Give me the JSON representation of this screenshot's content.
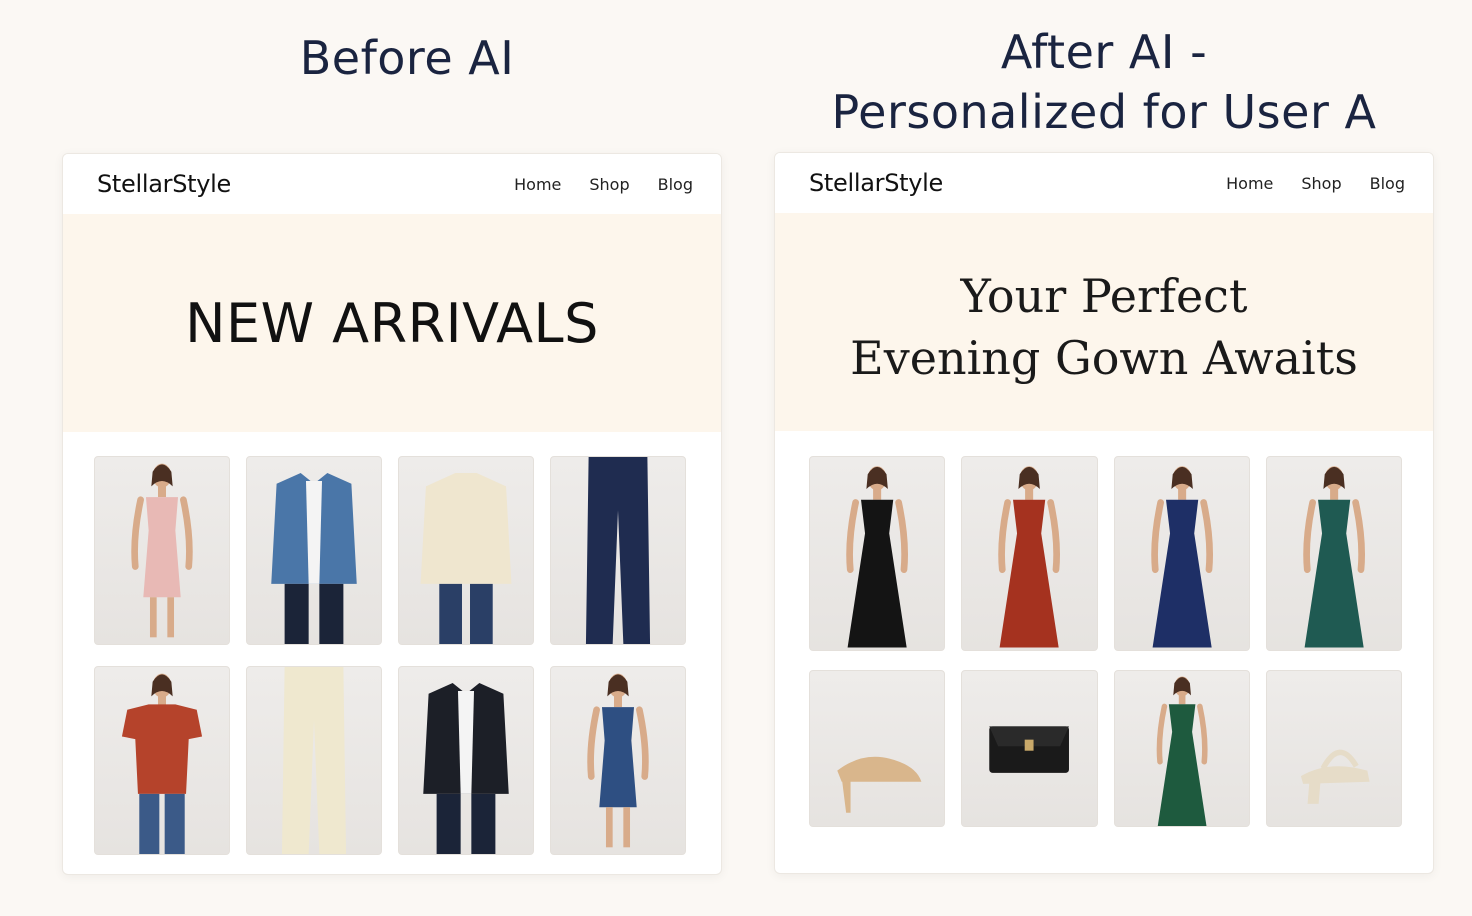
{
  "titles": {
    "left": "Before AI",
    "right_line1": "After AI -",
    "right_line2": "Personalized for User A"
  },
  "left_panel": {
    "brand": "StellarStyle",
    "nav": [
      "Home",
      "Shop",
      "Blog"
    ],
    "hero": "NEW ARRIVALS",
    "products": [
      {
        "icon": "pink-midi-dress-icon",
        "color": "#e8b9b5"
      },
      {
        "icon": "denim-jacket-icon",
        "color": "#4a76a8"
      },
      {
        "icon": "cream-sweater-icon",
        "color": "#efe6cf"
      },
      {
        "icon": "navy-trousers-icon",
        "color": "#1f2c50"
      },
      {
        "icon": "rust-tshirt-icon",
        "color": "#b5432b"
      },
      {
        "icon": "cream-trousers-icon",
        "color": "#efe8cf"
      },
      {
        "icon": "black-blazer-icon",
        "color": "#1c1f27"
      },
      {
        "icon": "blue-lace-dress-icon",
        "color": "#2e4f82"
      }
    ]
  },
  "right_panel": {
    "brand": "StellarStyle",
    "nav": [
      "Home",
      "Shop",
      "Blog"
    ],
    "hero_line1": "Your Perfect",
    "hero_line2": "Evening Gown Awaits",
    "products": [
      {
        "icon": "black-gown-icon",
        "color": "#141414"
      },
      {
        "icon": "red-gown-icon",
        "color": "#a5321f"
      },
      {
        "icon": "navy-gown-icon",
        "color": "#1e2f66"
      },
      {
        "icon": "green-sequin-dress-icon",
        "color": "#1f5a52"
      },
      {
        "icon": "nude-heels-icon",
        "color": "#d9b68c"
      },
      {
        "icon": "black-clutch-icon",
        "color": "#1a1a1a"
      },
      {
        "icon": "green-midi-dress-icon",
        "color": "#1e5a3e"
      },
      {
        "icon": "cream-sandals-icon",
        "color": "#e6dcc8"
      }
    ]
  }
}
